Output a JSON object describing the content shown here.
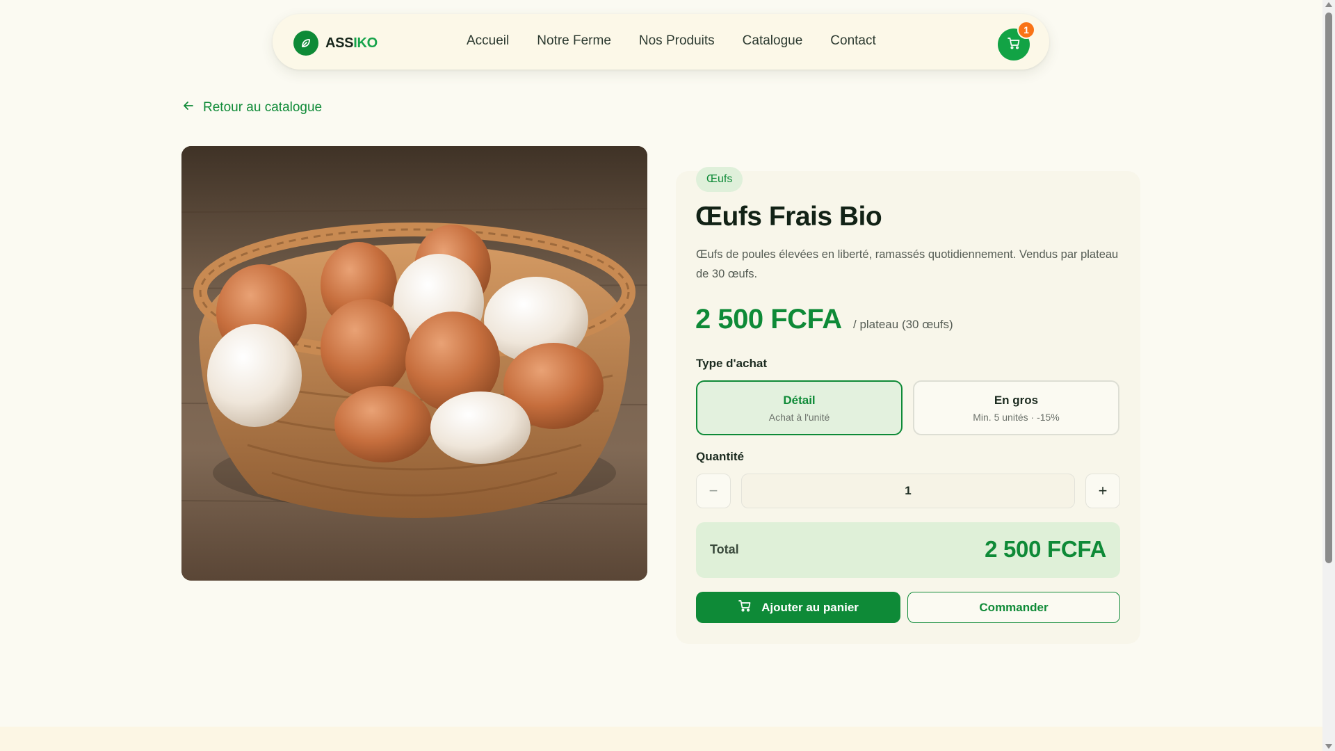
{
  "brand": {
    "name_part1": "ASS",
    "name_part2": "IKO",
    "primary_color": "#0e8a37",
    "accent_color": "#16a34a",
    "badge_color": "#f97316"
  },
  "nav": {
    "links": [
      "Accueil",
      "Notre Ferme",
      "Nos Produits",
      "Catalogue",
      "Contact"
    ],
    "cart_count": "1",
    "cart_icon": "cart-icon"
  },
  "back_link": {
    "label": "Retour au catalogue",
    "icon": "arrow-left-icon"
  },
  "product": {
    "category": "Œufs",
    "title": "Œufs Frais Bio",
    "description": "Œufs de poules élevées en liberté, ramassés quotidiennement. Vendus par plateau de 30 œufs.",
    "price": "2 500 FCFA",
    "price_unit": "/ plateau (30 œufs)",
    "image_icon": "egg-basket-photo"
  },
  "purchase_type": {
    "label": "Type d'achat",
    "options": [
      {
        "title": "Détail",
        "subtitle": "Achat à l'unité",
        "selected": true
      },
      {
        "title": "En gros",
        "subtitle": "Min. 5 unités · -15%",
        "selected": false
      }
    ]
  },
  "quantity": {
    "label": "Quantité",
    "value": "1",
    "minus": "−",
    "plus": "+"
  },
  "total": {
    "label": "Total",
    "value": "2 500 FCFA"
  },
  "actions": {
    "add_to_cart": "Ajouter au panier",
    "order": "Commander"
  }
}
